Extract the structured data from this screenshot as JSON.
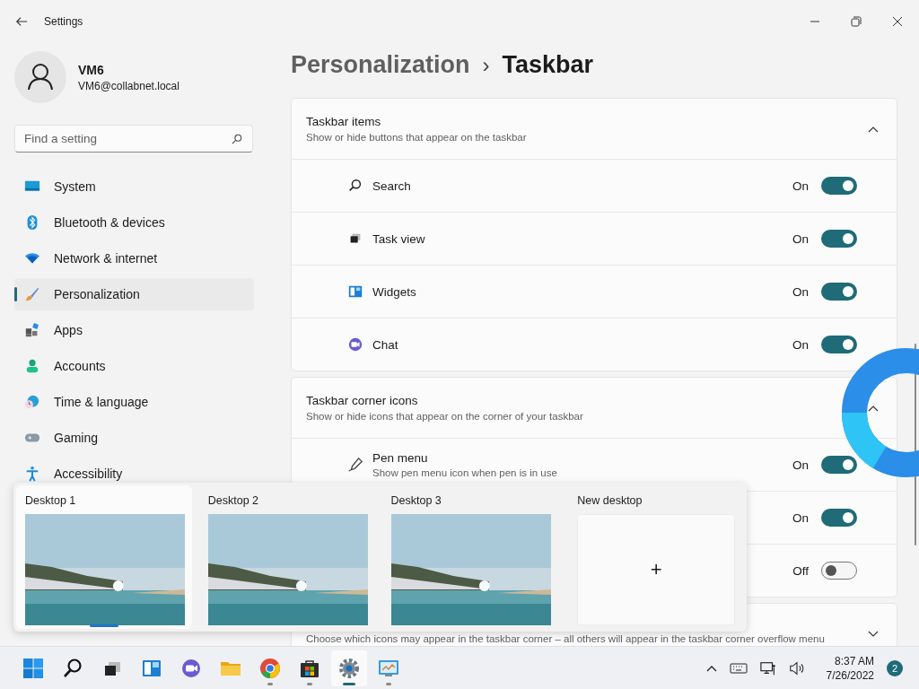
{
  "window": {
    "title": "Settings"
  },
  "user": {
    "name": "VM6",
    "email": "VM6@collabnet.local"
  },
  "search": {
    "placeholder": "Find a setting"
  },
  "nav": [
    {
      "label": "System",
      "kind": "system",
      "selected": false
    },
    {
      "label": "Bluetooth & devices",
      "kind": "bluetooth",
      "selected": false
    },
    {
      "label": "Network & internet",
      "kind": "network",
      "selected": false
    },
    {
      "label": "Personalization",
      "kind": "brush",
      "selected": true
    },
    {
      "label": "Apps",
      "kind": "apps",
      "selected": false
    },
    {
      "label": "Accounts",
      "kind": "accounts",
      "selected": false
    },
    {
      "label": "Time & language",
      "kind": "time",
      "selected": false
    },
    {
      "label": "Gaming",
      "kind": "gaming",
      "selected": false
    },
    {
      "label": "Accessibility",
      "kind": "accessibility",
      "selected": false
    }
  ],
  "breadcrumb": {
    "parent": "Personalization",
    "separator": "›",
    "current": "Taskbar"
  },
  "sections": [
    {
      "title": "Taskbar items",
      "subtitle": "Show or hide buttons that appear on the taskbar",
      "expanded": true,
      "items": [
        {
          "label": "Search",
          "kind": "search",
          "state_text": "On",
          "on": true
        },
        {
          "label": "Task view",
          "kind": "taskview",
          "state_text": "On",
          "on": true
        },
        {
          "label": "Widgets",
          "kind": "widgets",
          "state_text": "On",
          "on": true
        },
        {
          "label": "Chat",
          "kind": "chat",
          "state_text": "On",
          "on": true
        }
      ]
    },
    {
      "title": "Taskbar corner icons",
      "subtitle": "Show or hide icons that appear on the corner of your taskbar",
      "expanded": true,
      "items": [
        {
          "label": "Pen menu",
          "description": "Show pen menu icon when pen is in use",
          "kind": "pen",
          "state_text": "On",
          "on": true
        },
        {
          "state_text": "On",
          "on": true
        },
        {
          "state_text": "Off",
          "on": false
        }
      ]
    },
    {
      "subtitle": "Choose which icons may appear in the taskbar corner – all others will appear in the taskbar corner overflow menu",
      "expanded": false
    }
  ],
  "task_view": {
    "desktops": [
      {
        "label": "Desktop 1",
        "kind": "desktop",
        "selected": true
      },
      {
        "label": "Desktop 2",
        "kind": "desktop",
        "selected": false
      },
      {
        "label": "Desktop 3",
        "kind": "desktop",
        "selected": false
      },
      {
        "label": "New desktop",
        "kind": "new",
        "plus": "+",
        "selected": false
      }
    ]
  },
  "taskbar": {
    "apps": [
      {
        "kind": "start",
        "running": false,
        "active": false
      },
      {
        "kind": "search",
        "running": false,
        "active": false
      },
      {
        "kind": "taskview",
        "running": false,
        "active": false
      },
      {
        "kind": "widgets",
        "running": false,
        "active": false
      },
      {
        "kind": "chat",
        "running": false,
        "active": false
      },
      {
        "kind": "folder",
        "running": false,
        "active": false
      },
      {
        "kind": "browser",
        "running": true,
        "active": false
      },
      {
        "kind": "store",
        "running": true,
        "active": false
      },
      {
        "kind": "settings",
        "running": true,
        "active": true
      },
      {
        "kind": "monitor",
        "running": true,
        "active": false
      }
    ],
    "time": "8:37 AM",
    "date": "7/26/2022",
    "notifications": "2"
  }
}
